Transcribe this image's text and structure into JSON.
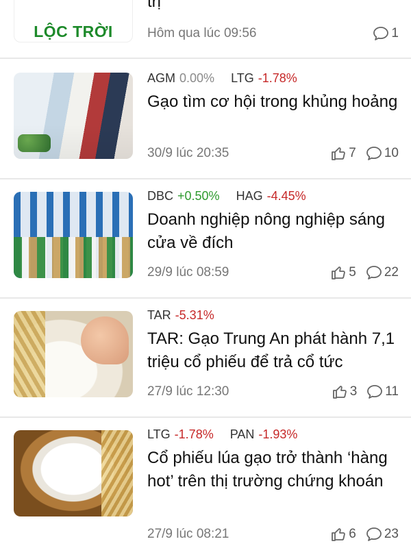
{
  "articles": [
    {
      "title": "trị",
      "tickers": [],
      "time": "Hôm qua lúc 09:56",
      "likes": null,
      "comments": "1",
      "thumb_logo_text": "LỘC TRỜI"
    },
    {
      "title": "Gạo tìm cơ hội trong khủng hoảng",
      "tickers": [
        {
          "symbol": "AGM",
          "change": "0.00%",
          "trend": "neutral"
        },
        {
          "symbol": "LTG",
          "change": "-1.78%",
          "trend": "down"
        }
      ],
      "time": "30/9 lúc 20:35",
      "likes": "7",
      "comments": "10"
    },
    {
      "title": "Doanh nghiệp nông nghiệp sáng cửa về đích",
      "tickers": [
        {
          "symbol": "DBC",
          "change": "+0.50%",
          "trend": "up"
        },
        {
          "symbol": "HAG",
          "change": "-4.45%",
          "trend": "down"
        }
      ],
      "time": "29/9 lúc 08:59",
      "likes": "5",
      "comments": "22"
    },
    {
      "title": "TAR: Gạo Trung An phát hành 7,1 triệu cổ phiếu để trả cổ tức",
      "tickers": [
        {
          "symbol": "TAR",
          "change": "-5.31%",
          "trend": "down"
        }
      ],
      "time": "27/9 lúc 12:30",
      "likes": "3",
      "comments": "11"
    },
    {
      "title": "Cổ phiếu lúa gạo trở thành ‘hàng hot’ trên thị trường chứng khoán",
      "tickers": [
        {
          "symbol": "LTG",
          "change": "-1.78%",
          "trend": "down"
        },
        {
          "symbol": "PAN",
          "change": "-1.93%",
          "trend": "down"
        }
      ],
      "time": "27/9 lúc 08:21",
      "likes": "6",
      "comments": "23"
    }
  ],
  "colors": {
    "down": "#c62828",
    "up": "#2e9a2e",
    "neutral": "#8a8a8a"
  },
  "icons": {
    "like": "thumbs-up-icon",
    "comment": "comment-bubble-icon"
  }
}
